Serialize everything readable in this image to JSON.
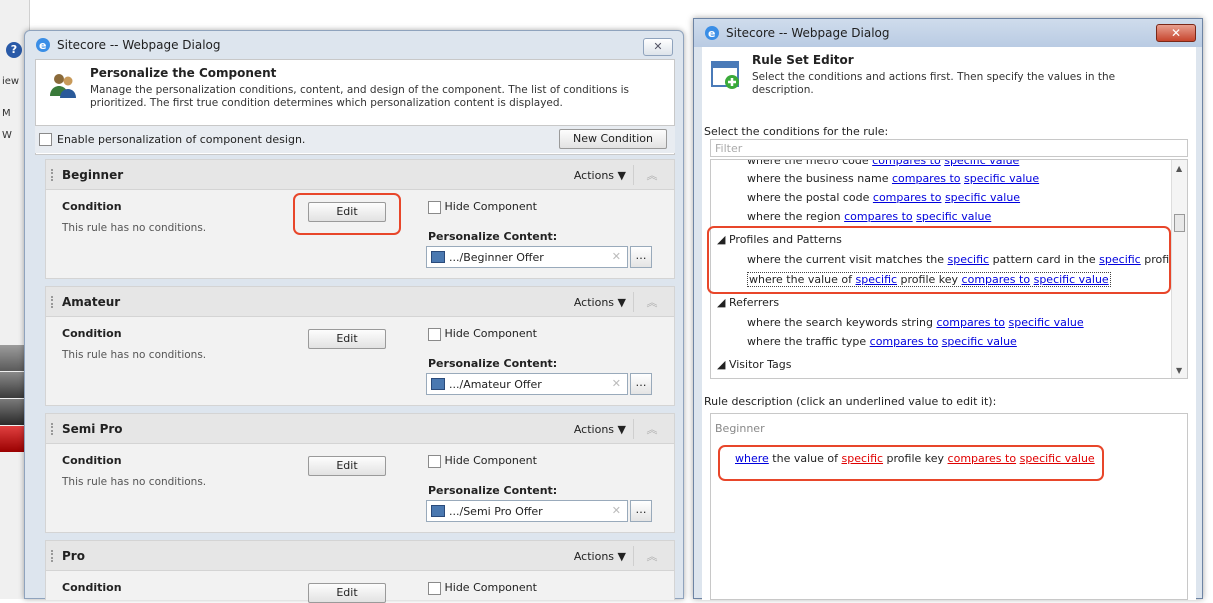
{
  "background": {
    "fragments": [
      "iew",
      "M",
      "W"
    ]
  },
  "left_dialog": {
    "title": "Sitecore -- Webpage Dialog",
    "close_label": "✕",
    "header": {
      "title": "Personalize the Component",
      "description": "Manage the personalization conditions, content, and design of the component. The list of conditions is prioritized. The first true condition determines which personalization content is displayed."
    },
    "enable_label": "Enable personalization of component design.",
    "new_condition_label": "New Condition",
    "actions_label": "Actions",
    "condition_label": "Condition",
    "no_conditions_text": "This rule has no conditions.",
    "edit_label": "Edit",
    "hide_component_label": "Hide Component",
    "personalize_content_label": "Personalize Content:",
    "sections": [
      {
        "name": "Beginner",
        "content_value": ".../Beginner Offer"
      },
      {
        "name": "Amateur",
        "content_value": ".../Amateur Offer"
      },
      {
        "name": "Semi Pro",
        "content_value": ".../Semi Pro Offer"
      },
      {
        "name": "Pro",
        "content_value": ""
      }
    ]
  },
  "right_dialog": {
    "title": "Sitecore -- Webpage Dialog",
    "header": {
      "title": "Rule Set Editor",
      "description": "Select the conditions and actions first. Then specify the values in the description."
    },
    "select_label": "Select the conditions for the rule:",
    "filter_placeholder": "Filter",
    "conditions": {
      "top_partial": {
        "pre": "where the metro code ",
        "l1": "compares to",
        "mid": " ",
        "l2": "specific value"
      },
      "business": {
        "pre": "where the business name ",
        "l1": "compares to",
        "mid": " ",
        "l2": "specific value"
      },
      "postal": {
        "pre": "where the postal code ",
        "l1": "compares to",
        "mid": " ",
        "l2": "specific value"
      },
      "region": {
        "pre": "where the region ",
        "l1": "compares to",
        "mid": " ",
        "l2": "specific value"
      },
      "group_profiles": "Profiles and Patterns",
      "pattern": {
        "pre": "where the current visit matches the ",
        "l1": "specific",
        "mid": " pattern card in the ",
        "l2": "specific",
        "post": " profile"
      },
      "profile_key": {
        "pre": "where the value of ",
        "l1": "specific",
        "mid": " profile key ",
        "l2": "compares to",
        "mid2": " ",
        "l3": "specific value"
      },
      "group_referrers": "Referrers",
      "keywords": {
        "pre": "where the search keywords string ",
        "l1": "compares to",
        "mid": " ",
        "l2": "specific value"
      },
      "traffic": {
        "pre": "where the traffic type ",
        "l1": "compares to",
        "mid": " ",
        "l2": "specific value"
      },
      "group_visitor": "Visitor Tags"
    },
    "rule_desc_label": "Rule description (click an underlined value to edit it):",
    "rule_name": "Beginner",
    "rule": {
      "l0": "where",
      "t1": " the value of ",
      "l1": "specific",
      "t2": " profile key ",
      "l2": "compares to",
      "t3": " ",
      "l3": "specific value"
    }
  },
  "colors": {
    "highlight": "#e8462a",
    "link": "#0000dd",
    "link_red": "#e00000"
  }
}
